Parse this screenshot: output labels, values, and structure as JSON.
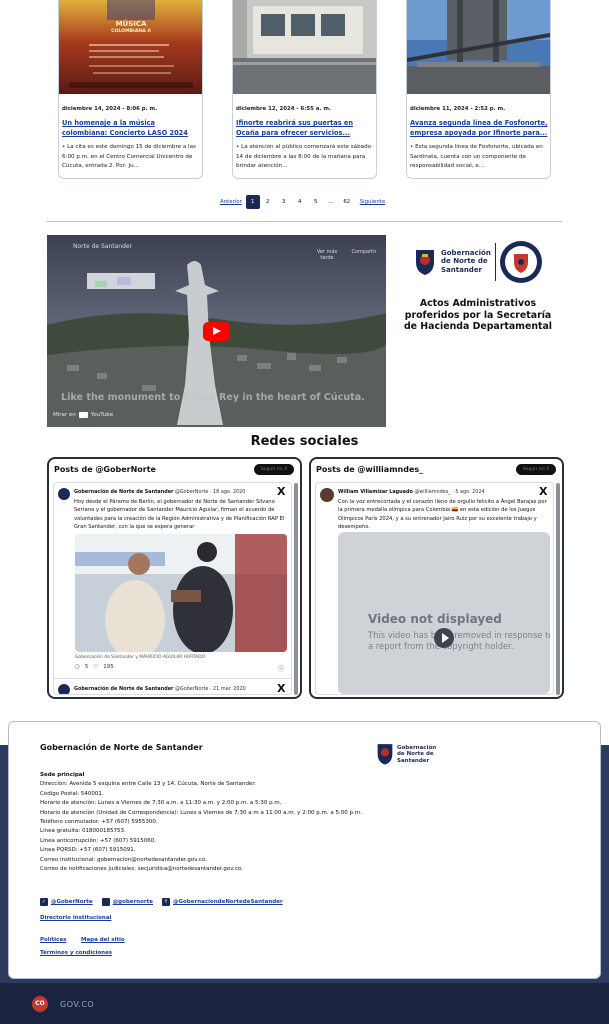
{
  "news": [
    {
      "date": "diciembre 14, 2024 - 8:06 p. m.",
      "title": "Un homenaje a la música colombiana: Concierto LASO 2024",
      "desc": "• La cita es este domingo 15 de diciembre a las 6:00 p.m. en el Centro Comercial Unicentro de Cúcuta, entrada 2.   Por: Ju..."
    },
    {
      "date": "diciembre 12, 2024 - 6:55 a. m.",
      "title": "Ifinorte reabrirá sus puertas en Ocaña para ofrecer servicios...",
      "desc": "• La atención al público comenzará este sábado 14 de diciembre a las 8:00 de la mañana para brindar atención..."
    },
    {
      "date": "diciembre 11, 2024 - 2:52 p. m.",
      "title": "Avanza segunda línea de Fosfonorte, empresa apoyada por Ifinorte para...",
      "desc": "• Esta segunda línea de Fosfonorte, ubicada en Sardinata, cuenta con un componente de responsabilidad social, e..."
    }
  ],
  "poster": {
    "line1": "MÚSICA",
    "line2": "COLOMBIANA II"
  },
  "pagination": {
    "prev": "Anterior",
    "pages": [
      "1",
      "2",
      "3",
      "4",
      "5",
      "...",
      "62"
    ],
    "next": "Siguiente",
    "active": "1"
  },
  "video": {
    "channel": "Norte de Santander",
    "caption": "Like the monument to Cristo Rey in the heart of Cúcuta.",
    "watch_later": "Ver más tarde",
    "share": "Compartir",
    "watch_on": "Mirar en",
    "yt": "YouTube"
  },
  "logo": {
    "line1": "Gobernación",
    "line2": "de Norte de",
    "line3": "Santander"
  },
  "actos": "Actos Administrativos proferidos por la Secretaría de Hacienda Departamental",
  "redes_title": "Redes sociales",
  "twitter": [
    {
      "header": "Posts de @GoberNorte",
      "follow": "Seguir en X",
      "posts": [
        {
          "user": "Gobernación de Norte de Santander",
          "handle": "@GoberNorte · 18 ago. 2020",
          "text": "Hoy desde el Páramo de Berlín, el gobernador de Norte de Santander Silvano Serrano y el gobernador de Santander Mauricio Aguilar, firman el acuerdo de voluntades para la creación de la Región Administrativa y de Planificación RAP El Gran Santander, con la que se espera generar",
          "caption": "Gobernación de Santander y MAURICIO AGUILAR HURTADO",
          "replies": "5",
          "likes": "195"
        },
        {
          "user": "Gobernación de Norte de Santander",
          "handle": "@GoberNorte · 21 mar. 2020"
        }
      ]
    },
    {
      "header": "Posts de @williamndes_",
      "follow": "Seguir en X",
      "posts": [
        {
          "user": "William Villamizar Laguado",
          "handle": "@williamndes_ · 5 ago. 2024",
          "text": "Con la voz entrecortada y el corazón lleno de orgullo felicito a Ángel Barajas por la primera medalla olímpica para Colombia 🇨🇴 en esta edición de los Juegos Olímpicos París 2024, y a su entrenador Jairo Ruiz por su excelente trabajo y desempeño.",
          "video_title": "Video not displayed",
          "video_text": "This video has been removed in response to a report from the copyright holder."
        }
      ]
    }
  ],
  "footer": {
    "title": "Gobernación de Norte de Santander",
    "sede_label": "Sede principal",
    "lines": [
      "Dirección: Avenida 5 esquina entre Calle 13 y 14, Cúcuta, Norte de Santander.",
      "Código Postal: 540001.",
      "Horario de atención: Lunes a Viernes de 7:30 a.m. a 11:30 a.m. y 2:00 p.m. a 5:30 p.m.",
      "Horario de atención (Unidad de Correspondencia): Lunes a Viernes de 7:30 a.m a 11:00 a.m. y 2:00 p.m. a 5:00 p.m.",
      "Teléfono conmutador: +57 (607) 5955300.",
      "Línea gratuita: 018000185753.",
      "Línea anticorrupción: +57 (607) 5915060.",
      "Línea PQRSD: +57 (607) 5915091.",
      "Correo institucional: gobernacion@nortedesantander.gov.co.",
      "Correo de notificaciones judiciales: secjuridica@nortedesantander.gov.co."
    ],
    "social": [
      "@GoberNorte",
      "@gobernorte",
      "@GobernaciondeNortedeSantander"
    ],
    "directorio": "Directorio institucional",
    "politicas": "Políticas",
    "mapa": "Mapa del sitio",
    "terminos": "Términos y condiciones"
  },
  "govco": {
    "badge": "CO",
    "label": "GOV.CO"
  },
  "colors": {
    "navy": "#1b2a55",
    "footer_band": "#2b3a5e",
    "link": "#1a3b9c",
    "youtube_red": "#ff0000"
  }
}
